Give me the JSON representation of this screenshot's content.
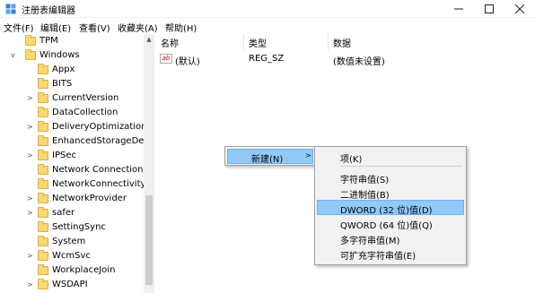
{
  "window": {
    "title": "注册表编辑器"
  },
  "menubar": [
    "文件(F)",
    "编辑(E)",
    "查看(V)",
    "收藏夹(A)",
    "帮助(H)"
  ],
  "tree": [
    {
      "label": "TPM",
      "expander": ""
    },
    {
      "label": "Windows",
      "expander": "v"
    },
    {
      "label": "Appx",
      "expander": ""
    },
    {
      "label": "BITS",
      "expander": ""
    },
    {
      "label": "CurrentVersion",
      "expander": ">"
    },
    {
      "label": "DataCollection",
      "expander": ""
    },
    {
      "label": "DeliveryOptimization",
      "expander": ">"
    },
    {
      "label": "EnhancedStorageDev",
      "expander": ""
    },
    {
      "label": "IPSec",
      "expander": ">"
    },
    {
      "label": "Network Connections",
      "expander": ""
    },
    {
      "label": "NetworkConnectivityS",
      "expander": ""
    },
    {
      "label": "NetworkProvider",
      "expander": ">"
    },
    {
      "label": "safer",
      "expander": ">"
    },
    {
      "label": "SettingSync",
      "expander": ""
    },
    {
      "label": "System",
      "expander": ""
    },
    {
      "label": "WcmSvc",
      "expander": ">"
    },
    {
      "label": "WorkplaceJoin",
      "expander": ""
    },
    {
      "label": "WSDAPI",
      "expander": ">"
    }
  ],
  "columns": {
    "name": "名称",
    "type": "类型",
    "data": "数据"
  },
  "values": [
    {
      "name": "(默认)",
      "type": "REG_SZ",
      "data": "(数值未设置)"
    }
  ],
  "context_menu": {
    "new_label": "新建(N)"
  },
  "submenu": {
    "items": [
      "项(K)",
      "字符串值(S)",
      "二进制值(B)",
      "DWORD (32 位)值(D)",
      "QWORD (64 位)值(Q)",
      "多字符串值(M)",
      "可扩充字符串值(E)"
    ],
    "selected_index": 3
  },
  "colors": {
    "highlight": "#91c9f7",
    "folder": "#f8d775"
  }
}
